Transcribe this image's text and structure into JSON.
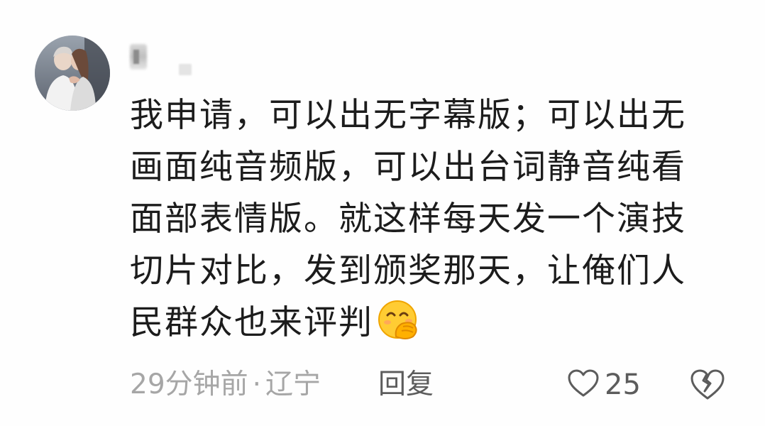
{
  "comment": {
    "text": "我申请，可以出无字幕版；可以出无画面纯音频版，可以出台词静音纯看面部表情版。就这样每天发一个演技切片对比，发到颁奖那天，让俺们人民群众也来评判",
    "emoji": "hand-over-mouth-face-emoji",
    "time": "29分钟前",
    "separator": "·",
    "location": "辽宁",
    "reply_label": "回复",
    "like_count": "25"
  },
  "icons": {
    "like": "heart-outline-icon",
    "dislike": "broken-heart-outline-icon"
  },
  "colors": {
    "text": "#1c1c1c",
    "meta": "#a6a6a6",
    "action": "#5c5c5c",
    "emoji_face": "#ffcc33"
  }
}
